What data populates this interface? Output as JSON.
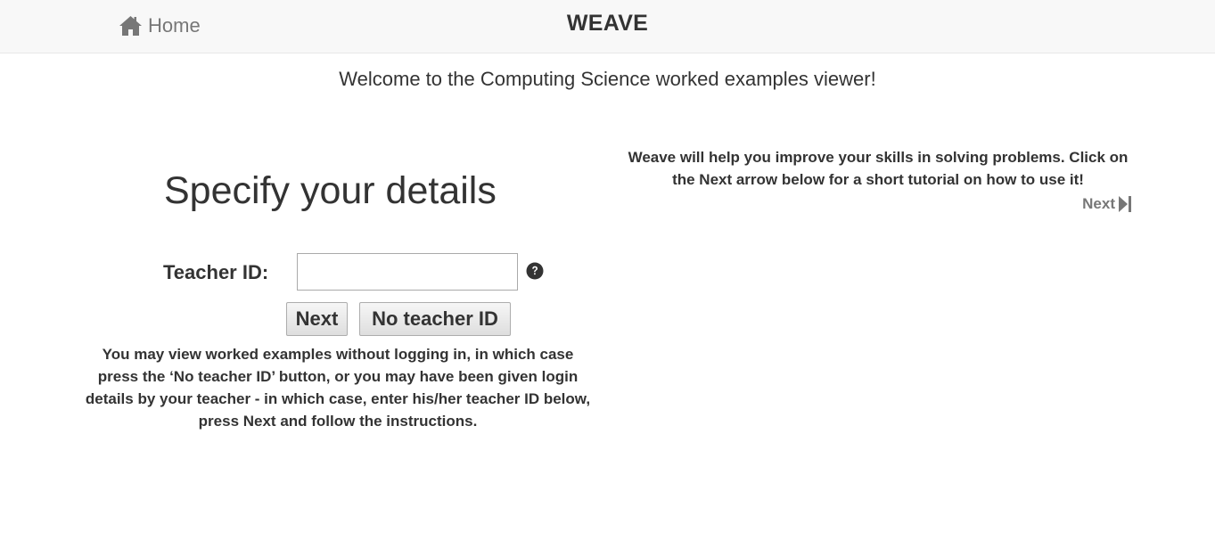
{
  "navbar": {
    "home_label": "Home",
    "brand": "WEAVE",
    "home_icon": "home-icon"
  },
  "welcome": "Welcome to the Computing Science worked examples viewer!",
  "details": {
    "heading": "Specify your details",
    "teacher_id_label": "Teacher ID:",
    "teacher_id_value": "",
    "help_icon": "question-circle-icon",
    "next_button": "Next",
    "no_teacher_button": "No teacher ID",
    "info": "You may view worked examples without logging in, in which case press the ‘No teacher ID’ button, or you may have been given login details by your teacher - in which case, enter his/her teacher ID below, press Next and follow the instructions."
  },
  "tutorial": {
    "text": "Weave will help you improve your skills in solving problems. Click on the Next arrow below for a short tutorial on how to use it!",
    "next_label": "Next",
    "next_icon": "step-forward-icon"
  }
}
